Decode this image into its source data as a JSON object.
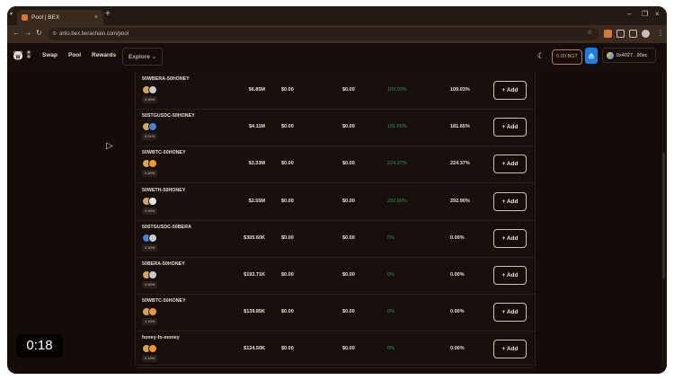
{
  "browser": {
    "tab_title": "Pool | BEX",
    "tab_close": "×",
    "new_tab": "+",
    "url": "artio.bex.berachain.com/pool",
    "window_controls": [
      "–",
      "❐",
      "×"
    ]
  },
  "header": {
    "nav": [
      "Swap",
      "Pool",
      "Rewards"
    ],
    "explore_label": "Explore ⌄",
    "bgt_balance": "0.00 BGT",
    "wallet_address": "0x4027...90ec"
  },
  "pools": [
    {
      "name": "50WBERA-50HONEY",
      "fee": "0.40%",
      "tvl": "$6.85M",
      "v1": "$0.00",
      "v2": "$0.00",
      "apy_green": "109.03%",
      "apy": "109.03%",
      "tokens": [
        "#d7a55a",
        "#c9c9c9"
      ]
    },
    {
      "name": "50STGUSDC-50HONEY",
      "fee": "0.01%",
      "tvl": "$4.11M",
      "v1": "$0.00",
      "v2": "$0.00",
      "apy_green": "181.65%",
      "apy": "181.65%",
      "tokens": [
        "#d7a55a",
        "#3f84d8"
      ]
    },
    {
      "name": "50WBTC-50HONEY",
      "fee": "0.40%",
      "tvl": "$3.33M",
      "v1": "$0.00",
      "v2": "$0.00",
      "apy_green": "224.37%",
      "apy": "224.37%",
      "tokens": [
        "#d7a55a",
        "#f0962a"
      ]
    },
    {
      "name": "50WETH-50HONEY",
      "fee": "0.40%",
      "tvl": "$2.55M",
      "v1": "$0.00",
      "v2": "$0.00",
      "apy_green": "292.90%",
      "apy": "292.90%",
      "tokens": [
        "#d7a55a",
        "#e8e8e8"
      ]
    },
    {
      "name": "50STGUSDC-50BERA",
      "fee": "0.40%",
      "tvl": "$305.60K",
      "v1": "$0.00",
      "v2": "$0.00",
      "apy_green": "0%",
      "apy": "0.00%",
      "tokens": [
        "#3f84d8",
        "#c9c9c9"
      ]
    },
    {
      "name": "50BERA-50HONEY",
      "fee": "0.40%",
      "tvl": "$192.71K",
      "v1": "$0.00",
      "v2": "$0.00",
      "apy_green": "0%",
      "apy": "0.00%",
      "tokens": [
        "#d7a55a",
        "#c9c9c9"
      ]
    },
    {
      "name": "50WBTC-50HONEY",
      "fee": "1.10%",
      "tvl": "$139.85K",
      "v1": "$0.00",
      "v2": "$0.00",
      "apy_green": "0%",
      "apy": "0.00%",
      "tokens": [
        "#d7a55a",
        "#f0962a"
      ]
    },
    {
      "name": "honey-fo-money",
      "fee": "0.15%",
      "tvl": "$124.50K",
      "v1": "$0.00",
      "v2": "$0.00",
      "apy_green": "0%",
      "apy": "0.00%",
      "tokens": [
        "#d7a55a",
        "#f0962a"
      ]
    }
  ],
  "add_label": "+ Add",
  "video_timer": "0:18"
}
